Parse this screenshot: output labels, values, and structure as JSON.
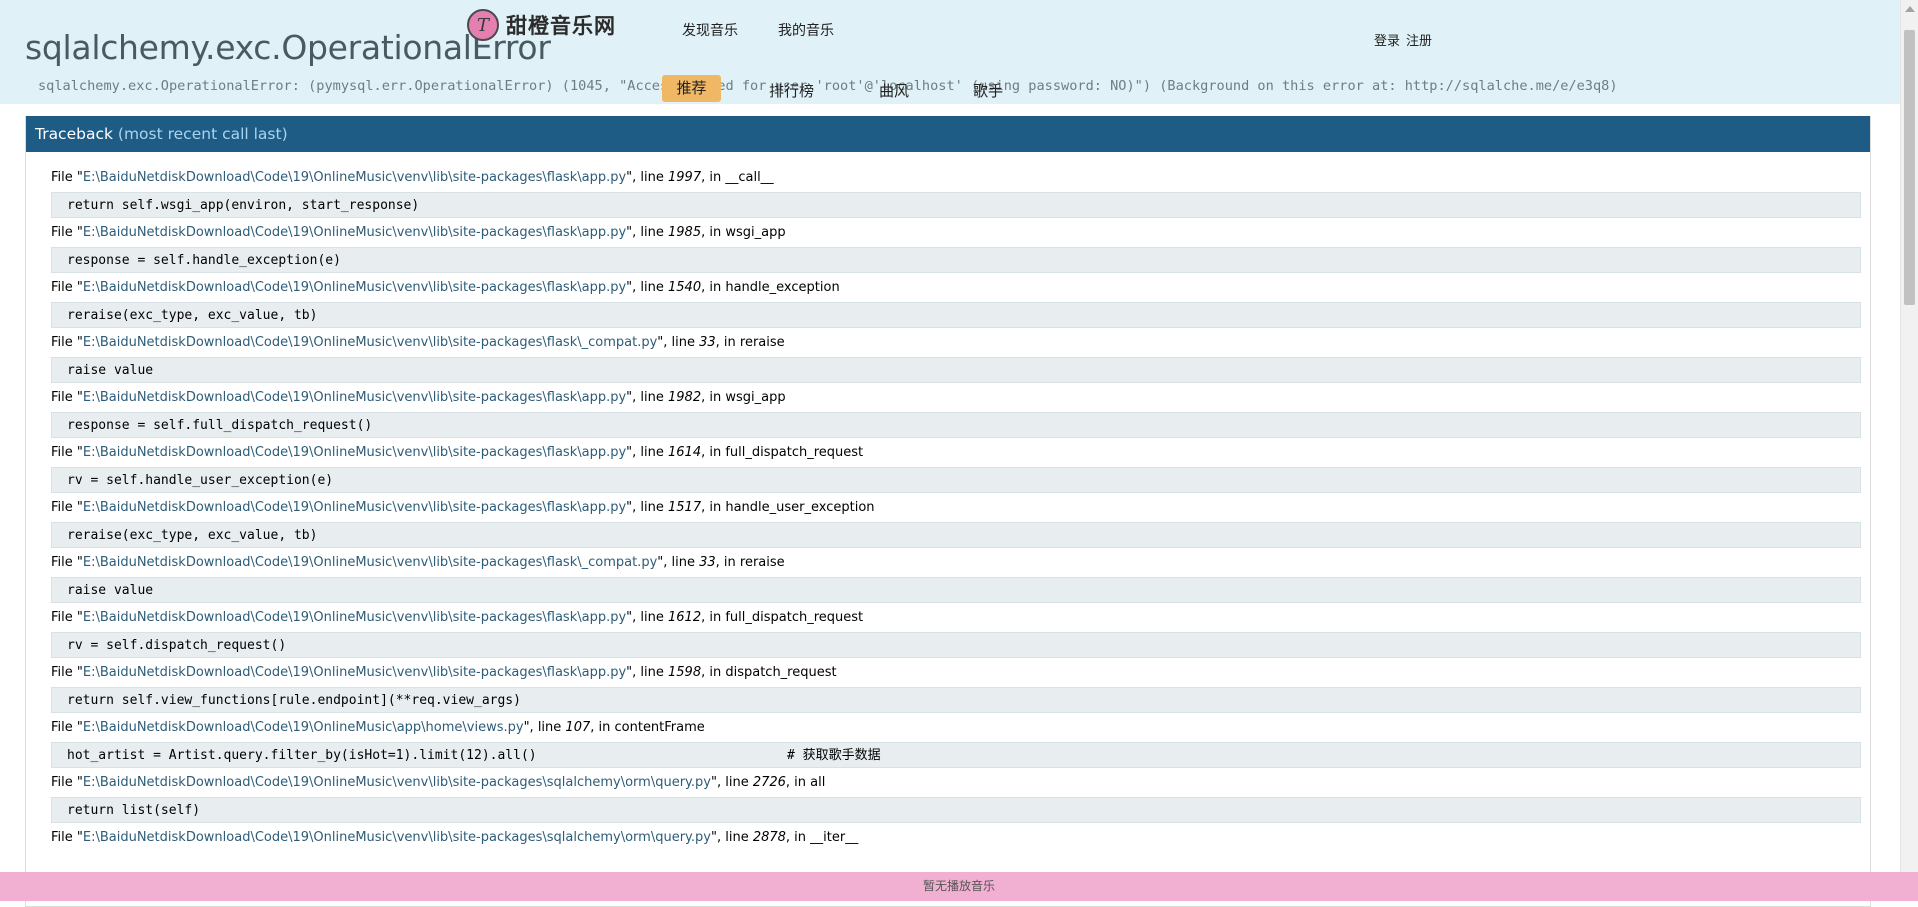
{
  "error": {
    "title": "sqlalchemy.exc.OperationalError",
    "message": "sqlalchemy.exc.OperationalError: (pymysql.err.OperationalError) (1045, \"Access denied for user 'root'@'localhost' (using password: NO)\") (Background on this error at: http://sqlalche.me/e/e3q8)"
  },
  "site_nav": {
    "logo_mark": "T",
    "logo_text": "甜橙音乐网",
    "discover": "发现音乐",
    "my_music": "我的音乐",
    "login": "登录",
    "register": "注册",
    "tabs": [
      "推荐",
      "排行榜",
      "曲风",
      "歌手"
    ]
  },
  "traceback": {
    "title": "Traceback",
    "subtitle": "(most recent call last)",
    "frames": [
      {
        "file": "E:\\BaiduNetdiskDownload\\Code\\19\\OnlineMusic\\venv\\lib\\site-packages\\flask\\app.py",
        "line": "1997",
        "func": "__call__",
        "code": "return self.wsgi_app(environ, start_response)",
        "comment": ""
      },
      {
        "file": "E:\\BaiduNetdiskDownload\\Code\\19\\OnlineMusic\\venv\\lib\\site-packages\\flask\\app.py",
        "line": "1985",
        "func": "wsgi_app",
        "code": "response = self.handle_exception(e)",
        "comment": ""
      },
      {
        "file": "E:\\BaiduNetdiskDownload\\Code\\19\\OnlineMusic\\venv\\lib\\site-packages\\flask\\app.py",
        "line": "1540",
        "func": "handle_exception",
        "code": "reraise(exc_type, exc_value, tb)",
        "comment": ""
      },
      {
        "file": "E:\\BaiduNetdiskDownload\\Code\\19\\OnlineMusic\\venv\\lib\\site-packages\\flask\\_compat.py",
        "line": "33",
        "func": "reraise",
        "code": "raise value",
        "comment": ""
      },
      {
        "file": "E:\\BaiduNetdiskDownload\\Code\\19\\OnlineMusic\\venv\\lib\\site-packages\\flask\\app.py",
        "line": "1982",
        "func": "wsgi_app",
        "code": "response = self.full_dispatch_request()",
        "comment": ""
      },
      {
        "file": "E:\\BaiduNetdiskDownload\\Code\\19\\OnlineMusic\\venv\\lib\\site-packages\\flask\\app.py",
        "line": "1614",
        "func": "full_dispatch_request",
        "code": "rv = self.handle_user_exception(e)",
        "comment": ""
      },
      {
        "file": "E:\\BaiduNetdiskDownload\\Code\\19\\OnlineMusic\\venv\\lib\\site-packages\\flask\\app.py",
        "line": "1517",
        "func": "handle_user_exception",
        "code": "reraise(exc_type, exc_value, tb)",
        "comment": ""
      },
      {
        "file": "E:\\BaiduNetdiskDownload\\Code\\19\\OnlineMusic\\venv\\lib\\site-packages\\flask\\_compat.py",
        "line": "33",
        "func": "reraise",
        "code": "raise value",
        "comment": ""
      },
      {
        "file": "E:\\BaiduNetdiskDownload\\Code\\19\\OnlineMusic\\venv\\lib\\site-packages\\flask\\app.py",
        "line": "1612",
        "func": "full_dispatch_request",
        "code": "rv = self.dispatch_request()",
        "comment": ""
      },
      {
        "file": "E:\\BaiduNetdiskDownload\\Code\\19\\OnlineMusic\\venv\\lib\\site-packages\\flask\\app.py",
        "line": "1598",
        "func": "dispatch_request",
        "code": "return self.view_functions[rule.endpoint](**req.view_args)",
        "comment": ""
      },
      {
        "file": "E:\\BaiduNetdiskDownload\\Code\\19\\OnlineMusic\\app\\home\\views.py",
        "line": "107",
        "func": "contentFrame",
        "code": "hot_artist = Artist.query.filter_by(isHot=1).limit(12).all()",
        "comment": "# 获取歌手数据"
      },
      {
        "file": "E:\\BaiduNetdiskDownload\\Code\\19\\OnlineMusic\\venv\\lib\\site-packages\\sqlalchemy\\orm\\query.py",
        "line": "2726",
        "func": "all",
        "code": "return list(self)",
        "comment": ""
      },
      {
        "file": "E:\\BaiduNetdiskDownload\\Code\\19\\OnlineMusic\\venv\\lib\\site-packages\\sqlalchemy\\orm\\query.py",
        "line": "2878",
        "func": "__iter__",
        "code": "",
        "comment": ""
      }
    ]
  },
  "player": {
    "status": "暂无播放音乐"
  },
  "colors": {
    "header_bg": "#e0f1f7",
    "traceback_header_bg": "#1f5c85",
    "active_tab_bg": "#f0b764",
    "player_bg": "#f1b0d2"
  }
}
